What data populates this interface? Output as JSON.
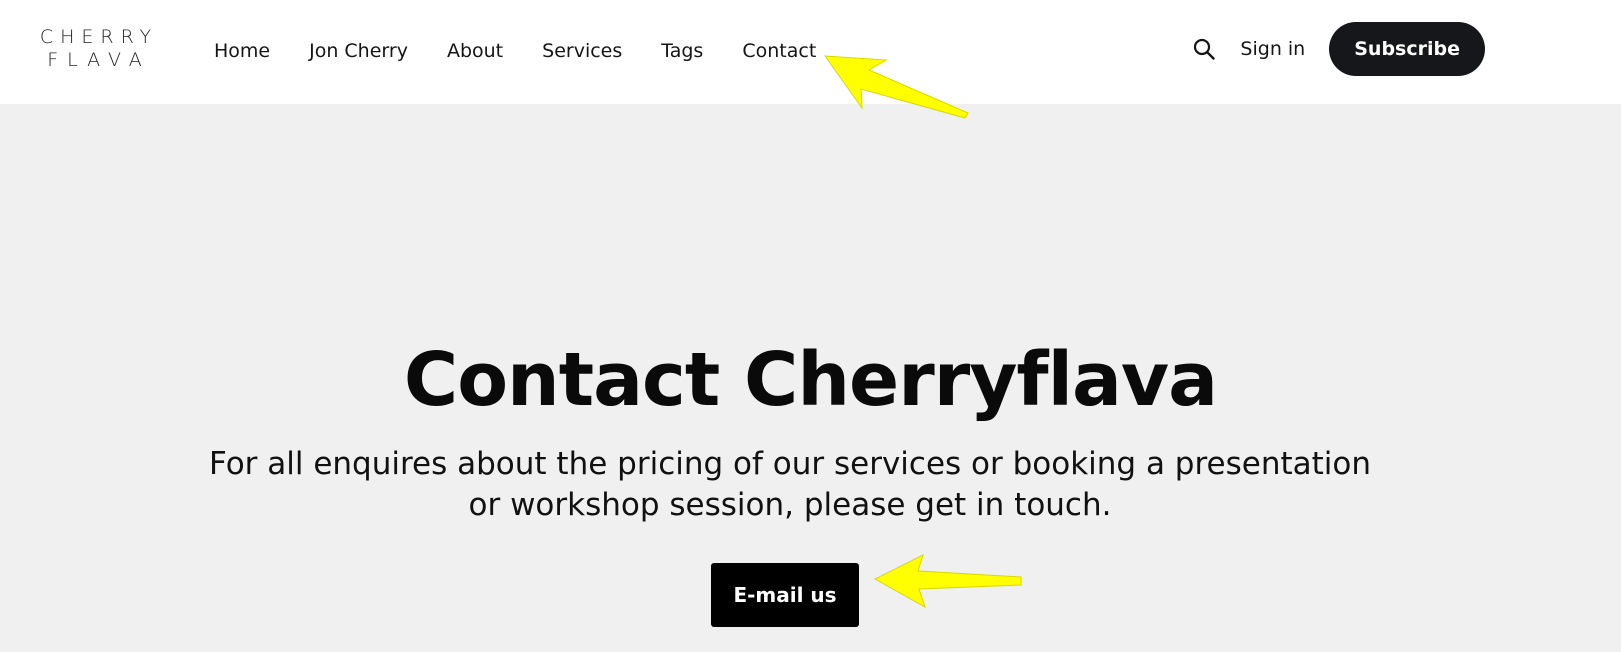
{
  "brand": {
    "line1": "CHERRY",
    "line2": "FLAVA"
  },
  "nav": {
    "items": [
      {
        "label": "Home"
      },
      {
        "label": "Jon Cherry"
      },
      {
        "label": "About"
      },
      {
        "label": "Services"
      },
      {
        "label": "Tags"
      },
      {
        "label": "Contact"
      }
    ]
  },
  "header_actions": {
    "search_icon": "search-icon",
    "signin_label": "Sign in",
    "subscribe_label": "Subscribe"
  },
  "hero": {
    "title": "Contact Cherryflava",
    "description": "For all enquires about the pricing of our services or booking a presentation or workshop session, please get in touch.",
    "email_button_label": "E-mail us"
  },
  "annotations": {
    "arrow_color": "#ffff00"
  }
}
